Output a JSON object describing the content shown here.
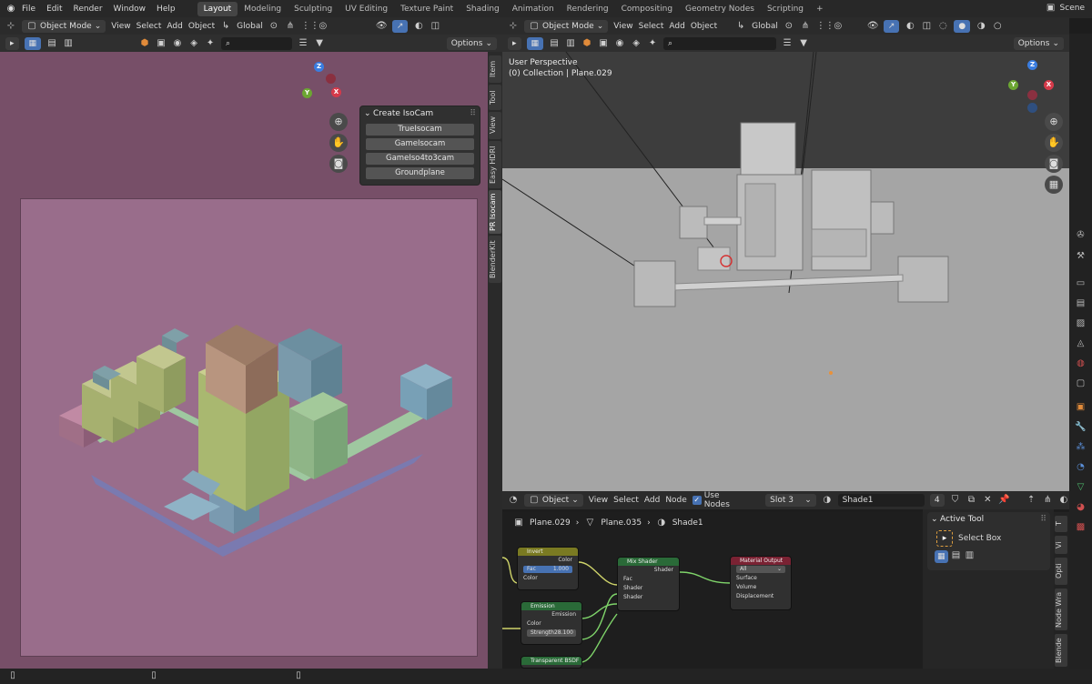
{
  "menu": [
    "File",
    "Edit",
    "Render",
    "Window",
    "Help"
  ],
  "workspaces": [
    "Layout",
    "Modeling",
    "Sculpting",
    "UV Editing",
    "Texture Paint",
    "Shading",
    "Animation",
    "Rendering",
    "Compositing",
    "Geometry Nodes",
    "Scripting"
  ],
  "add_workspace": "+",
  "scene_name": "Scene",
  "left_view": {
    "mode": "Object Mode",
    "menus": [
      "View",
      "Select",
      "Add",
      "Object"
    ],
    "orientation": "Global",
    "options": "Options",
    "panel_title": "Create IsoCam",
    "panel_buttons": [
      "TrueIsocam",
      "GameIsocam",
      "GameIso4to3cam",
      "Groundplane"
    ],
    "side_tabs": [
      "Item",
      "Tool",
      "View",
      "Easy HDRI",
      "PR Isocam",
      "BlenderKit"
    ],
    "background_color": "#774f68",
    "camera_frame_color": "#996d8b"
  },
  "right_view": {
    "mode": "Object Mode",
    "menus": [
      "View",
      "Select",
      "Add",
      "Object"
    ],
    "orientation": "Global",
    "options": "Options",
    "overlay_line1": "User Perspective",
    "overlay_line2": "(0) Collection | Plane.029"
  },
  "node_editor": {
    "object_mode": "Object",
    "menus": [
      "View",
      "Select",
      "Add",
      "Node"
    ],
    "use_nodes": "Use Nodes",
    "slot": "Slot 3",
    "material": "Shade1",
    "users": "4",
    "breadcrumb": [
      "Plane.029",
      "Plane.035",
      "Shade1"
    ],
    "nodes": {
      "invert": {
        "title": "Invert",
        "out": "Color",
        "fac_label": "Fac",
        "fac_value": "1.000",
        "in": "Color"
      },
      "mix": {
        "title": "Mix Shader",
        "out": "Shader",
        "in1": "Fac",
        "in2": "Shader",
        "in3": "Shader"
      },
      "output": {
        "title": "Material Output",
        "target": "All",
        "in1": "Surface",
        "in2": "Volume",
        "in3": "Displacement"
      },
      "emission": {
        "title": "Emission",
        "out": "Emission",
        "in1": "Color",
        "strength_label": "Strength",
        "strength_value": "28.100"
      },
      "transparent": {
        "title": "Transparent BSDF"
      }
    },
    "side_tabs": [
      "T",
      "Vi",
      "Opti",
      "Node Wra",
      "Blende"
    ]
  },
  "active_tool": {
    "title": "Active Tool",
    "tool": "Select Box"
  },
  "colors": {
    "select_blue": "#4772b3",
    "axis_x": "#d63a4a",
    "axis_y": "#6ca632",
    "axis_z": "#3a7de0"
  }
}
